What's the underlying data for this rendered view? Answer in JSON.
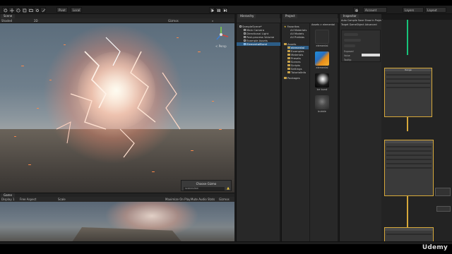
{
  "toolbar": {
    "center_tab": "Pivot",
    "local_tab": "Local",
    "account": "Account",
    "layers": "Layers",
    "layout": "Layout"
  },
  "scene": {
    "tab": "Scene",
    "shading": "Shaded",
    "mode_2d": "2D",
    "gizmos": "Gizmos",
    "tooltip_title": "Choose Gizmo",
    "tooltip_field": "sceneview",
    "persp": "< Persp"
  },
  "game": {
    "tab": "Game",
    "display": "Display 1",
    "aspect": "Free Aspect",
    "scale": "Scale",
    "maximize": "Maximize On Play",
    "mute": "Mute Audio",
    "stats": "Stats",
    "gizmos": "Gizmos"
  },
  "hierarchy": {
    "tab": "Hierarchy",
    "items": [
      {
        "label": "SampleScene*",
        "selected": false
      },
      {
        "label": "Main Camera",
        "selected": false
      },
      {
        "label": "Directional Light",
        "selected": false
      },
      {
        "label": "Post-process Volume",
        "selected": false
      },
      {
        "label": "Example Assets",
        "selected": false
      },
      {
        "label": "ElementalBurst",
        "selected": true
      }
    ]
  },
  "project": {
    "tab": "Project",
    "favorites": "Favorites",
    "fav_items": [
      "All Materials",
      "All Models",
      "All Prefabs"
    ],
    "assets_root": "Assets",
    "asset_folders": [
      "elemental",
      "Examples",
      "Materials",
      "Presets",
      "Scenes",
      "Scripts",
      "Settings",
      "TutorialInfo"
    ],
    "packages": "Packages",
    "breadcrumb": "Assets > elemental",
    "files": [
      "elemental",
      "elemental",
      "ice burst",
      "bubble"
    ]
  },
  "inspector": {
    "tab": "Inspector",
    "graph_tab": "elemental",
    "graph_toolbar": [
      "Auto",
      "Compile",
      "Save",
      "Show in Project"
    ],
    "target": "Target GameObject",
    "advanced": "Advanced",
    "properties": [
      "Exposed",
      "Value",
      "Tooltip"
    ],
    "ranges": [
      "Range"
    ]
  },
  "watermark": "Udemy",
  "colors": {
    "accent_blue": "#2c5d87",
    "node_border": "#d6a83a",
    "flow_green": "#17c37a",
    "spark": "#ff8a4a"
  }
}
